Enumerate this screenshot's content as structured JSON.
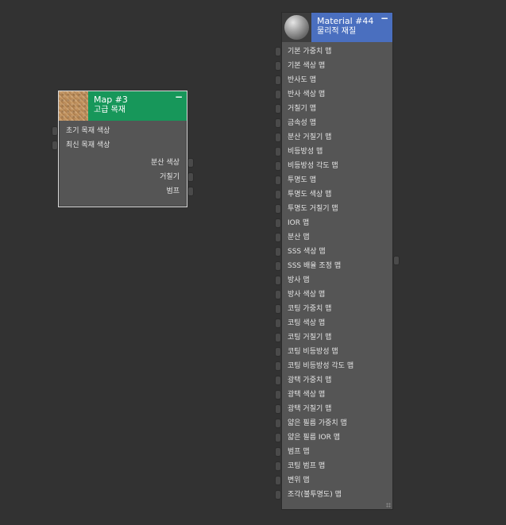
{
  "colors": {
    "canvas_bg": "#323232",
    "node_bg": "#555555",
    "map_header": "#17975a",
    "material_header": "#4a6fbf"
  },
  "map_node": {
    "title": "Map #3",
    "subtitle": "고급 목재",
    "thumbnail_icon": "wood-texture-thumbnail",
    "minimize_label": "−",
    "inputs": [
      {
        "label": "초기 목재 색상"
      },
      {
        "label": "최신 목재 색상"
      }
    ],
    "outputs": [
      {
        "label": "분산 색상"
      },
      {
        "label": "거칠기"
      },
      {
        "label": "범프"
      }
    ]
  },
  "material_node": {
    "title": "Material #44",
    "subtitle": "물리적 재질",
    "thumbnail_icon": "material-sphere-thumbnail",
    "minimize_label": "−",
    "inputs": [
      {
        "label": "기본 가중치 맵"
      },
      {
        "label": "기본 색상 맵"
      },
      {
        "label": "반사도 맵"
      },
      {
        "label": "반사 색상 맵"
      },
      {
        "label": "거칠기 맵"
      },
      {
        "label": "금속성 맵"
      },
      {
        "label": "분산 거칠기 맵"
      },
      {
        "label": "비등방성 맵"
      },
      {
        "label": "비등방성 각도 맵"
      },
      {
        "label": "투명도 맵"
      },
      {
        "label": "투명도 색상 맵"
      },
      {
        "label": "투명도 거칠기 맵"
      },
      {
        "label": "IOR 맵"
      },
      {
        "label": "분산 맵"
      },
      {
        "label": "SSS 색상 맵"
      },
      {
        "label": "SSS 배율 조정 맵"
      },
      {
        "label": "방사 맵"
      },
      {
        "label": "방사 색상 맵"
      },
      {
        "label": "코팅 가중치 맵"
      },
      {
        "label": "코팅 색상 맵"
      },
      {
        "label": "코팅 거칠기 맵"
      },
      {
        "label": "코팅 비등방성 맵"
      },
      {
        "label": "코팅 비등방성 각도 맵"
      },
      {
        "label": "광택 가중치 맵"
      },
      {
        "label": "광택 색상 맵"
      },
      {
        "label": "광택 거칠기 맵"
      },
      {
        "label": "얇은 필름 가중치 맵"
      },
      {
        "label": "얇은 필름 IOR 맵"
      },
      {
        "label": "범프 맵"
      },
      {
        "label": "코팅 범프 맵"
      },
      {
        "label": "변위 맵"
      },
      {
        "label": "조각(불투명도) 맵"
      }
    ]
  }
}
